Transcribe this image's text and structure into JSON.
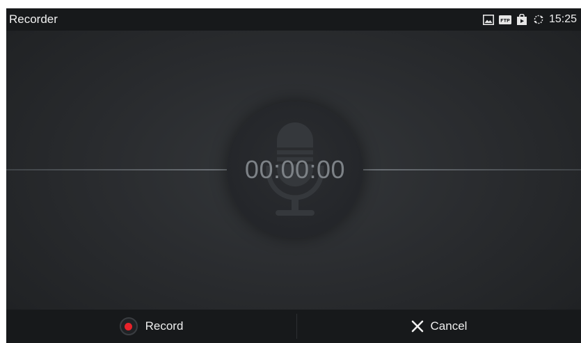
{
  "app": {
    "title": "Recorder"
  },
  "status_bar": {
    "icons": [
      "image-icon",
      "ftp-icon",
      "store-bag-icon",
      "sync-icon"
    ],
    "ftp_label": "FTP",
    "time": "15:25"
  },
  "recorder": {
    "timer": "00:00:00",
    "mic_icon": "microphone-icon"
  },
  "actions": {
    "record_label": "Record",
    "record_icon": "record-dot-icon",
    "record_dot_color": "#e8222a",
    "cancel_label": "Cancel",
    "cancel_icon": "close-icon"
  },
  "colors": {
    "background": "#2a2c2f",
    "bars": "#17191b",
    "timer_text": "#7d8287",
    "accent_red": "#e8222a"
  }
}
